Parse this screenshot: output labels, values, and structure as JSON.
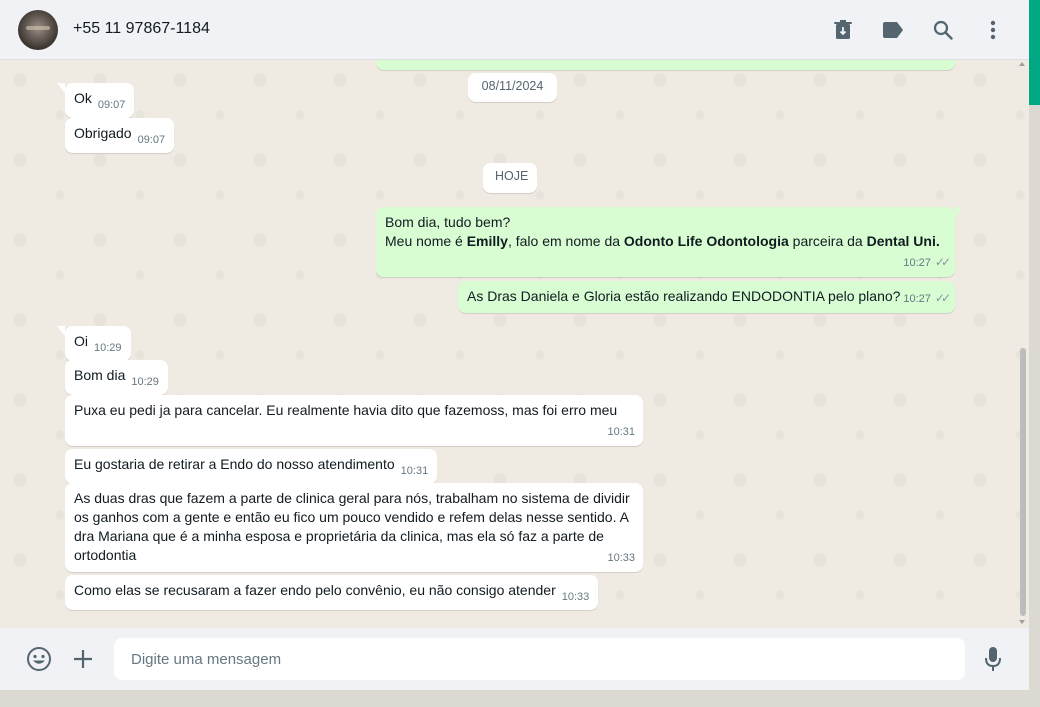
{
  "header": {
    "contact_name": "+55 11 97867-1184",
    "icons": [
      "archive-icon",
      "label-icon",
      "search-icon",
      "menu-icon"
    ]
  },
  "chat": {
    "date_chips": {
      "previous": "08/11/2024",
      "today": "HOJE"
    },
    "messages": [
      {
        "direction": "in",
        "text": "Ok",
        "time": "09:07"
      },
      {
        "direction": "in",
        "text": "Obrigado",
        "time": "09:07"
      },
      {
        "direction": "out",
        "line1": "Bom dia, tudo bem?",
        "line2_a": "Meu nome é ",
        "line2_bold1": "Emilly",
        "line2_b": ", falo em nome da ",
        "line2_bold2": "Odonto Life Odontologia",
        "line2_c": " parceira da ",
        "line2_bold3": "Dental Uni.",
        "time": "10:27",
        "status": "read"
      },
      {
        "direction": "out",
        "text": "As Dras Daniela e Gloria estão realizando ENDODONTIA pelo plano?",
        "time": "10:27",
        "status": "read"
      },
      {
        "direction": "in",
        "text": "Oi",
        "time": "10:29"
      },
      {
        "direction": "in",
        "text": "Bom dia",
        "time": "10:29"
      },
      {
        "direction": "in",
        "text": "Puxa eu pedi ja para cancelar. Eu realmente havia dito que fazemoss, mas foi erro meu",
        "time": "10:31"
      },
      {
        "direction": "in",
        "text": "Eu gostaria de retirar a Endo do nosso atendimento",
        "time": "10:31"
      },
      {
        "direction": "in",
        "text": "As duas dras que fazem a parte de clinica geral para nós, trabalham no sistema de dividir os ganhos com a gente e então eu fico um pouco vendido e refem delas nesse sentido. A dra Mariana que é a minha esposa e proprietária da clinica, mas ela só faz a parte de ortodontia",
        "time": "10:33"
      },
      {
        "direction": "in",
        "text": "Como elas se recusaram a fazer endo pelo convênio, eu não consigo atender",
        "time": "10:33"
      }
    ]
  },
  "footer": {
    "placeholder": "Digite uma mensagem",
    "icons": [
      "emoji-icon",
      "attach-plus-icon",
      "microphone-icon"
    ]
  },
  "colors": {
    "accent": "#00a884",
    "outgoing_bubble": "#d9fdd3",
    "incoming_bubble": "#ffffff",
    "chat_background": "#efeae2",
    "header_background": "#f0f2f5"
  }
}
